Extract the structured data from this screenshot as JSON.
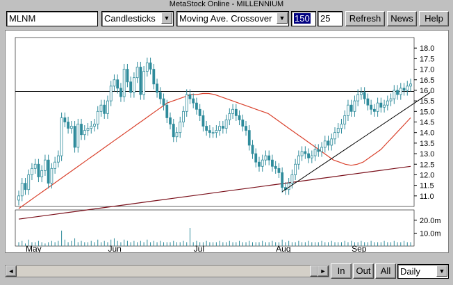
{
  "window": {
    "title": "MetaStock Online - MILLENNIUM"
  },
  "toolbar": {
    "symbol": "MLNM",
    "chart_style": "Candlesticks",
    "indicator": "Moving Ave. Crossover",
    "period_short": "150",
    "period_long": "25",
    "refresh_label": "Refresh",
    "news_label": "News",
    "help_label": "Help"
  },
  "bottom": {
    "in_label": "In",
    "out_label": "Out",
    "all_label": "All",
    "interval": "Daily",
    "scroll_left": "◄",
    "scroll_right": "►",
    "combo_arrow": "▼"
  },
  "colors": {
    "candle": "#2e8b9b",
    "ma_short": "#d9412c",
    "ma_long": "#7a0f1a",
    "volume": "#2e8b9b",
    "trendline": "#000000"
  },
  "chart_data": {
    "type": "candlestick",
    "price_axis": {
      "ticks": [
        "18.0",
        "17.5",
        "17.0",
        "16.5",
        "16.0",
        "15.5",
        "15.0",
        "14.5",
        "14.0",
        "13.5",
        "13.0",
        "12.5",
        "12.0",
        "11.5",
        "11.0"
      ],
      "ylim": [
        10.5,
        18.5
      ]
    },
    "volume_axis": {
      "ticks": [
        "20.0m",
        "10.0m"
      ],
      "ylim": [
        0,
        28
      ]
    },
    "x_labels": [
      "May",
      "Jun",
      "Jul",
      "Aug",
      "Sep"
    ],
    "x_label_index": [
      4,
      29,
      55,
      80,
      103
    ],
    "horizontal_line": 15.95,
    "trendline": {
      "from": [
        80,
        11.2
      ],
      "to": [
        125,
        15.9
      ]
    },
    "closes": [
      11.0,
      11.6,
      11.3,
      12.0,
      12.3,
      12.5,
      11.9,
      12.2,
      12.7,
      11.6,
      12.3,
      12.6,
      12.9,
      14.7,
      14.5,
      14.2,
      14.3,
      13.3,
      14.4,
      13.9,
      14.1,
      14.2,
      14.3,
      14.4,
      15.0,
      15.3,
      14.9,
      15.5,
      16.2,
      16.5,
      16.1,
      15.7,
      17.0,
      16.4,
      15.9,
      16.6,
      17.1,
      15.8,
      16.9,
      17.3,
      17.0,
      16.3,
      15.9,
      15.6,
      15.3,
      14.7,
      14.4,
      13.8,
      14.0,
      14.5,
      15.0,
      15.8,
      15.6,
      15.4,
      15.1,
      14.8,
      14.3,
      14.1,
      14.0,
      14.0,
      14.1,
      14.3,
      14.2,
      14.6,
      14.9,
      15.1,
      14.8,
      14.6,
      14.3,
      14.1,
      13.4,
      13.0,
      12.6,
      12.4,
      12.7,
      12.9,
      12.7,
      12.4,
      12.3,
      12.1,
      11.4,
      11.3,
      11.6,
      12.0,
      12.5,
      12.9,
      13.1,
      13.0,
      12.8,
      12.9,
      13.2,
      13.1,
      13.3,
      13.6,
      13.4,
      13.7,
      14.0,
      14.2,
      14.4,
      14.8,
      15.3,
      15.0,
      15.5,
      15.8,
      15.9,
      15.6,
      15.3,
      15.1,
      15.0,
      15.4,
      15.2,
      15.3,
      15.5,
      15.6,
      16.0,
      15.8,
      16.1,
      16.0,
      16.2,
      16.3
    ],
    "ma_short": [
      10.4,
      10.6,
      10.8,
      11.0,
      11.2,
      11.4,
      11.6,
      11.8,
      12.0,
      12.2,
      12.4,
      12.6,
      12.8,
      13.0,
      13.2,
      13.4,
      13.6,
      13.8,
      14.0,
      14.2,
      14.4,
      14.6,
      14.8,
      15.0,
      15.2,
      15.4,
      15.5,
      15.6,
      15.7,
      15.8,
      15.8,
      15.85,
      15.85,
      15.8,
      15.7,
      15.6,
      15.5,
      15.4,
      15.3,
      15.2,
      15.1,
      15.0,
      14.9,
      14.7,
      14.5,
      14.3,
      14.1,
      13.9,
      13.7,
      13.5,
      13.3,
      13.1,
      12.9,
      12.7,
      12.6,
      12.5,
      12.45,
      12.5,
      12.6,
      12.8,
      13.0,
      13.2,
      13.5,
      13.8,
      14.1,
      14.4,
      14.7
    ],
    "ma_long": [
      9.9,
      10.0,
      10.1,
      10.2,
      10.3,
      10.4,
      10.5,
      10.6,
      10.7,
      10.8,
      10.9,
      11.0,
      11.1,
      11.2,
      11.3,
      11.4,
      11.5,
      11.6,
      11.7,
      11.8,
      11.9,
      12.0,
      12.1,
      12.2,
      12.3,
      12.4
    ],
    "volume": [
      3,
      4,
      2,
      5,
      3,
      3,
      4,
      3,
      2,
      3,
      4,
      3,
      4,
      12,
      5,
      3,
      4,
      6,
      3,
      4,
      3,
      3,
      4,
      3,
      5,
      3,
      4,
      3,
      5,
      6,
      4,
      3,
      5,
      4,
      3,
      4,
      3,
      4,
      3,
      5,
      3,
      4,
      3,
      4,
      3,
      3,
      3,
      4,
      3,
      3,
      4,
      3,
      14,
      3,
      4,
      3,
      3,
      4,
      3,
      3,
      3,
      4,
      3,
      3,
      4,
      3,
      3,
      4,
      3,
      3,
      4,
      3,
      3,
      3,
      4,
      3,
      3,
      4,
      3,
      3,
      5,
      3,
      4,
      3,
      3,
      4,
      3,
      3,
      4,
      3,
      3,
      3,
      4,
      3,
      3,
      4,
      3,
      3,
      3,
      4,
      3,
      4,
      3,
      3,
      4,
      3,
      3,
      4,
      3,
      3,
      3,
      4,
      3,
      3,
      4,
      3,
      3,
      4,
      3,
      3
    ]
  }
}
